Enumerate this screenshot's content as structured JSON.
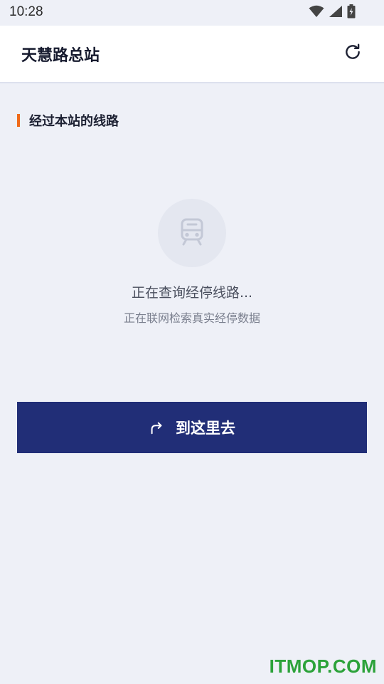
{
  "status_bar": {
    "time": "10:28"
  },
  "header": {
    "title": "天慧路总站",
    "refresh_icon": "refresh-icon"
  },
  "section": {
    "title": "经过本站的线路",
    "accent_color": "#f06a1a"
  },
  "loading": {
    "icon": "train-icon",
    "title": "正在查询经停线路...",
    "subtitle": "正在联网检索真实经停数据"
  },
  "action": {
    "label": "到这里去",
    "icon": "directions-arrow-icon",
    "color": "#212e77"
  },
  "watermark": {
    "text": "ITMOP.COM"
  }
}
